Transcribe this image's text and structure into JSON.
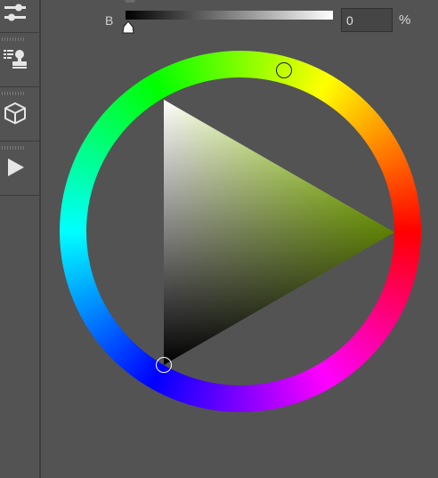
{
  "brightness": {
    "label": "B",
    "value": "0",
    "unit": "%"
  },
  "toolbar": {
    "tools": [
      {
        "icon": "adjustment-sliders-icon"
      },
      {
        "icon": "stamp-list-icon"
      },
      {
        "icon": "3d-cube-icon"
      },
      {
        "icon": "play-icon"
      }
    ]
  },
  "color_picker": {
    "mode": "hsb-wheel-triangle",
    "hue_color": "#b7ff00",
    "accent_colors": {
      "background": "#535353",
      "toolbar_divider": "#3e3e3e"
    }
  }
}
